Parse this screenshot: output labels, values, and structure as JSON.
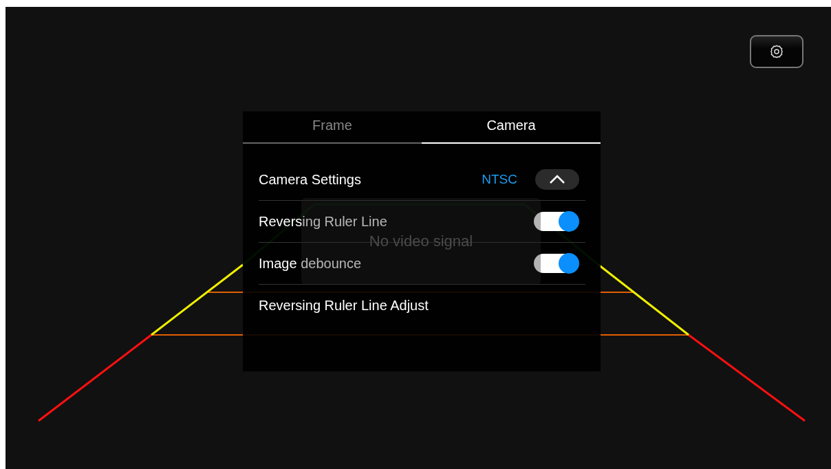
{
  "video": {
    "message": "No video signal"
  },
  "tabs": [
    {
      "label": "Frame",
      "selected": false
    },
    {
      "label": "Camera",
      "selected": true
    }
  ],
  "rows": [
    {
      "kind": "select",
      "label": "Camera Settings",
      "value": "NTSC",
      "expanded": true
    },
    {
      "kind": "toggle",
      "label": "Reversing Ruler Line",
      "on": true
    },
    {
      "kind": "toggle",
      "label": "Image debounce",
      "on": true
    },
    {
      "kind": "link",
      "label": "Reversing Ruler Line Adjust"
    }
  ]
}
